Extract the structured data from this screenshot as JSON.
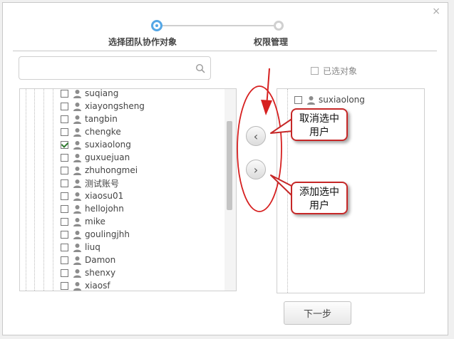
{
  "dialog": {
    "close_glyph": "×",
    "steps": [
      {
        "label": "选择团队协作对象",
        "active": true
      },
      {
        "label": "权限管理",
        "active": false
      }
    ],
    "search": {
      "value": "",
      "placeholder": ""
    },
    "tree": {
      "users": [
        {
          "name": "suqiang",
          "checked": false
        },
        {
          "name": "xiayongsheng",
          "checked": false
        },
        {
          "name": "tangbin",
          "checked": false
        },
        {
          "name": "chengke",
          "checked": false
        },
        {
          "name": "suxiaolong",
          "checked": true
        },
        {
          "name": "guxuejuan",
          "checked": false
        },
        {
          "name": "zhuhongmei",
          "checked": false
        },
        {
          "name": "测试账号",
          "checked": false
        },
        {
          "name": "xiaosu01",
          "checked": false
        },
        {
          "name": "hellojohn",
          "checked": false
        },
        {
          "name": "mike",
          "checked": false
        },
        {
          "name": "goulingjhh",
          "checked": false
        },
        {
          "name": "liuq",
          "checked": false
        },
        {
          "name": "Damon",
          "checked": false
        },
        {
          "name": "shenxy",
          "checked": false
        },
        {
          "name": "xiaosf",
          "checked": false
        },
        {
          "name": "",
          "checked": false
        }
      ]
    },
    "selected_toggle_label": "已选对象",
    "selected_users": [
      {
        "name": "suxiaolong"
      }
    ],
    "next_button": "下一步"
  },
  "annotations": {
    "remove_callout": [
      "取消选中",
      "用户"
    ],
    "add_callout": [
      "添加选中",
      "用户"
    ],
    "color": "#d62020"
  },
  "colors": {
    "accent": "#55a7e6",
    "annotation": "#d62020"
  }
}
